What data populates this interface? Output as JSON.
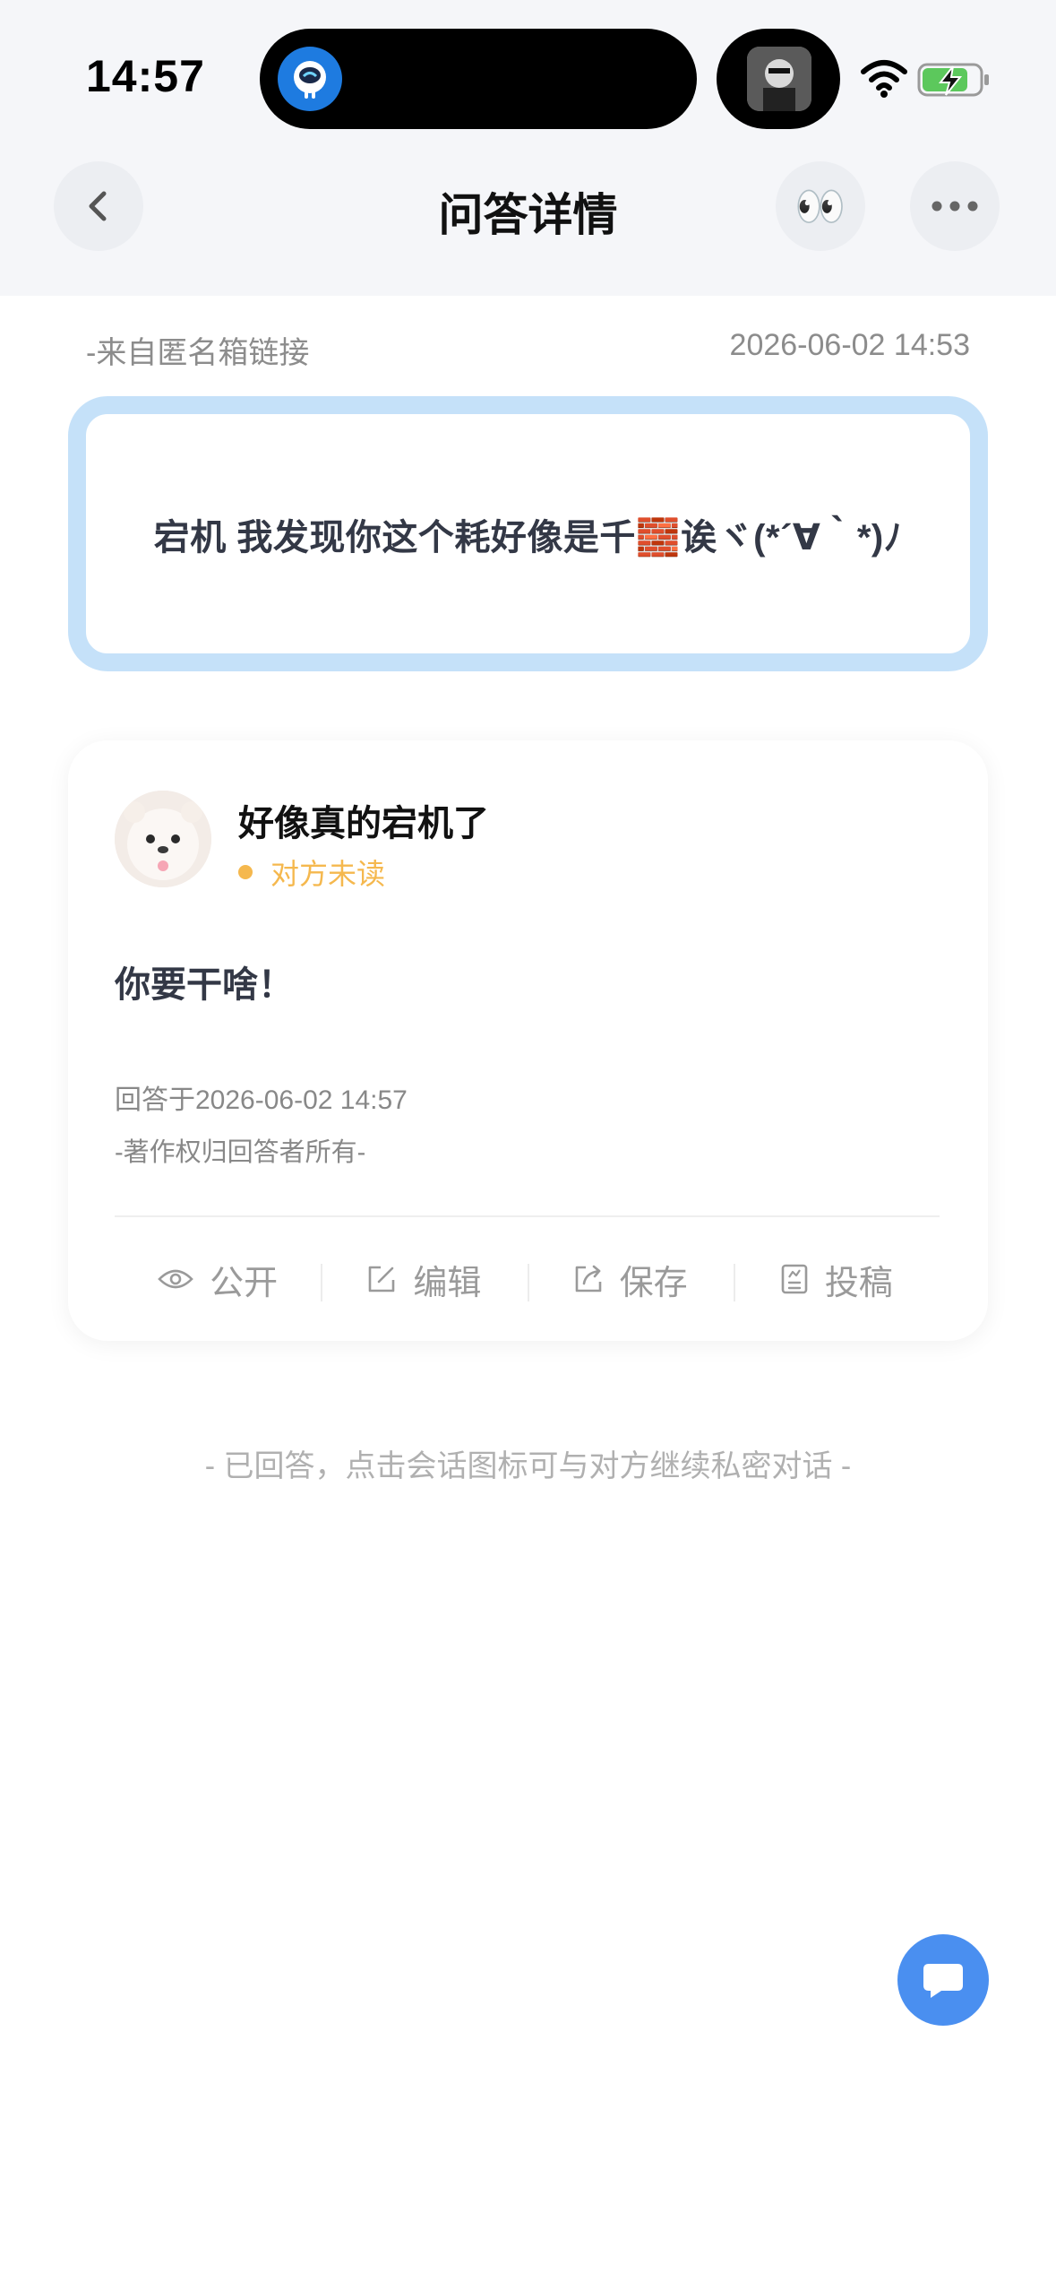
{
  "status_bar": {
    "time": "14:57",
    "icons": [
      "wifi-icon",
      "battery-charging-icon"
    ],
    "island_app_icon": "robot-app-icon",
    "island_thumbnail": "media-thumbnail"
  },
  "nav": {
    "title": "问答详情",
    "back_icon": "chevron-left-icon",
    "eyes_emoji": "👀",
    "more_icon": "more-dots-icon"
  },
  "question": {
    "source": "-来自匿名箱链接",
    "timestamp": "2026-06-02 14:53",
    "text": "宕机 我发现你这个耗好像是千🧱诶ヾ(*´∀｀*)ﾉ",
    "border_color": "#c5e1f9"
  },
  "answer": {
    "answerer_name": "好像真的宕机了",
    "read_status": "对方未读",
    "status_color": "#f5b84e",
    "content": "你要干啥！",
    "answered_at": "回答于2026-06-02 14:57",
    "copyright": "-著作权归回答者所有-",
    "actions": [
      {
        "label": "公开",
        "icon": "eye-icon"
      },
      {
        "label": "编辑",
        "icon": "edit-icon"
      },
      {
        "label": "保存",
        "icon": "share-save-icon"
      },
      {
        "label": "投稿",
        "icon": "document-icon"
      }
    ]
  },
  "footer": {
    "hint": "- 已回答，点击会话图标可与对方继续私密对话 -"
  },
  "fab": {
    "icon": "chat-bubble-icon",
    "color": "#4a8ff0"
  }
}
